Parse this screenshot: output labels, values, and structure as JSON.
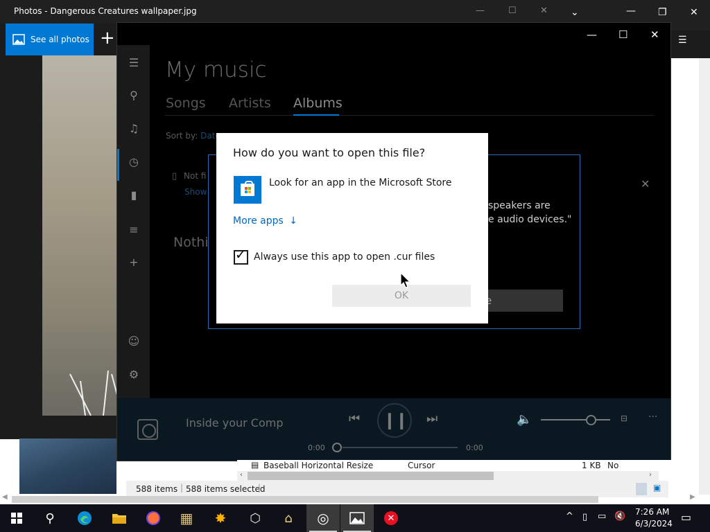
{
  "photos_window": {
    "title": "Photos - Dangerous Creatures wallpaper.jpg",
    "see_all_label": "See all photos",
    "add_label": "+"
  },
  "music": {
    "heading": "My music",
    "tabs": [
      "Songs",
      "Artists",
      "Albums"
    ],
    "sort_label": "Sort by:",
    "sort_value": "Date",
    "not_found": "Not fi",
    "show_link": "Show",
    "nothing_text": "Nothi",
    "notice_line1": "speakers are",
    "notice_line2": "e audio devices.\"",
    "notice_btn_fragment": "e",
    "player": {
      "track_title": "Inside your Comp",
      "time_elapsed": "0:00",
      "time_total": "0:00",
      "volume_level": 0.72
    }
  },
  "dialog": {
    "title": "How do you want to open this file?",
    "store_option": "Look for an app in the Microsoft Store",
    "more_apps": "More apps",
    "more_apps_arrow": "↓",
    "always_label": "Always use this app to open .cur files",
    "always_checked": true,
    "ok_label": "OK"
  },
  "explorer": {
    "row": {
      "name": "Baseball Horizontal Resize",
      "type": "Cursor",
      "size": "1 KB",
      "flag": "No"
    },
    "status_items": "588 items",
    "status_selected": "588 items selected",
    "ellipsis": "···"
  },
  "taskbar": {
    "time": "7:26 AM",
    "date": "6/3/2024"
  },
  "colors": {
    "accent": "#0078d4",
    "link": "#0067c0",
    "taskbar": "#101018"
  }
}
